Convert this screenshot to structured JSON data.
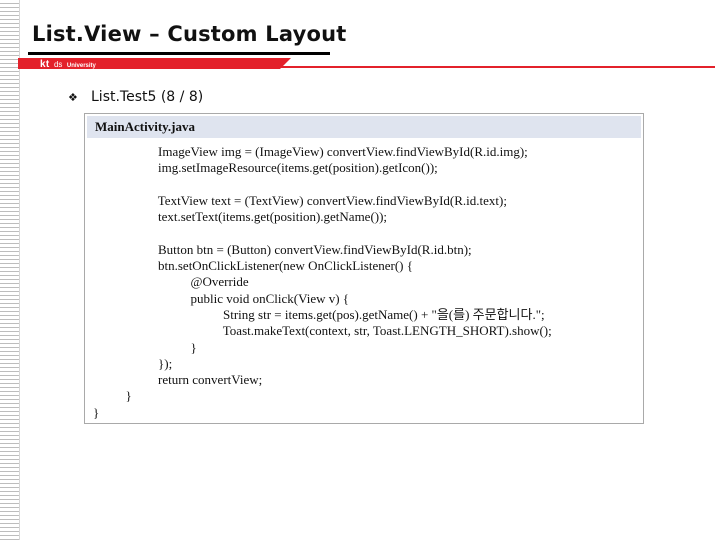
{
  "slide": {
    "title": "List.View – Custom Layout"
  },
  "brand": {
    "kt": "kt",
    "ds": "ds",
    "university": "University",
    "colors": {
      "accent": "#e3212b",
      "code_header_bg": "#dfe4ef"
    }
  },
  "bullet": {
    "icon": "diamond-bullet-icon",
    "text": "List.Test5 (8 / 8)"
  },
  "code": {
    "filename": "MainActivity.java",
    "lines": [
      "                    ImageView img = (ImageView) convertView.findViewById(R.id.img);",
      "                    img.setImageResource(items.get(position).getIcon());",
      "",
      "                    TextView text = (TextView) convertView.findViewById(R.id.text);",
      "                    text.setText(items.get(position).getName());",
      "",
      "                    Button btn = (Button) convertView.findViewById(R.id.btn);",
      "                    btn.setOnClickListener(new OnClickListener() {",
      "                              @Override",
      "                              public void onClick(View v) {",
      "                                        String str = items.get(pos).getName() + \"을(를) 주문합니다.\";",
      "                                        Toast.makeText(context, str, Toast.LENGTH_SHORT).show();",
      "                              }",
      "                    });",
      "                    return convertView;",
      "          }",
      "}"
    ]
  }
}
